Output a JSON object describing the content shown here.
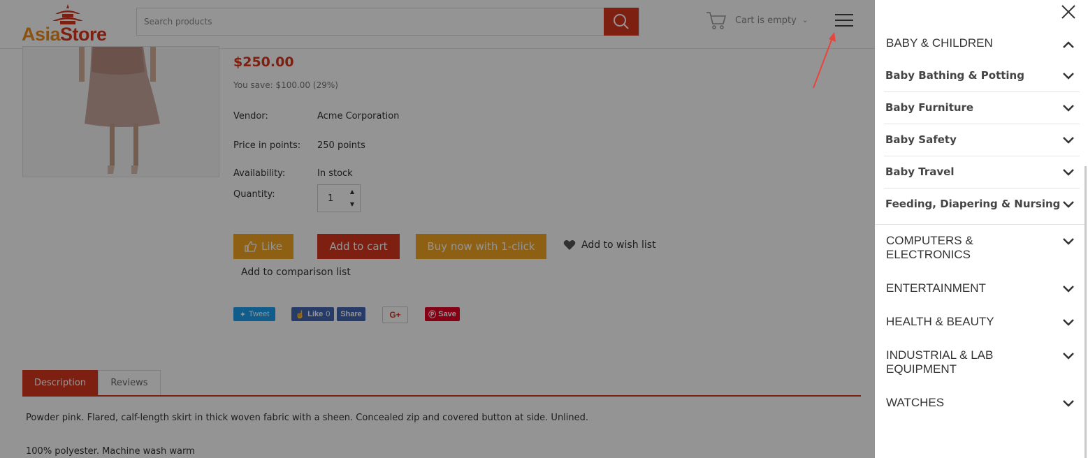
{
  "header": {
    "logo_part1": "Asia",
    "logo_part2": "Store",
    "search_placeholder": "Search products",
    "cart_label": "Cart is empty"
  },
  "product": {
    "price": "$250.00",
    "you_save": "You save: $100.00 (29%)",
    "attributes": [
      {
        "label": "Vendor:",
        "value": "Acme Corporation"
      },
      {
        "label": "Price in points:",
        "value": "250 points"
      },
      {
        "label": "Availability:",
        "value": "In stock"
      },
      {
        "label": "Quantity:",
        "value": ""
      }
    ],
    "quantity": "1",
    "buttons": {
      "like": "Like",
      "add_to_cart": "Add to cart",
      "buy_now": "Buy now with 1-click",
      "wish": "Add to wish list",
      "compare": "Add to comparison list"
    },
    "social": {
      "tweet": "Tweet",
      "fb_like": "Like",
      "fb_count": "0",
      "share": "Share",
      "gplus": "G+",
      "pin_save": "Save"
    },
    "tabs": [
      "Description",
      "Reviews"
    ],
    "description": [
      "Powder pink. Flared, calf-length skirt in thick woven fabric with a sheen. Concealed zip and covered button at side. Unlined.",
      "100% polyester. Machine wash warm"
    ]
  },
  "drawer": {
    "categories": [
      {
        "label": "BABY & CHILDREN",
        "expanded": true
      },
      {
        "label": "COMPUTERS & ELECTRONICS",
        "expanded": false
      },
      {
        "label": "ENTERTAINMENT",
        "expanded": false
      },
      {
        "label": "HEALTH & BEAUTY",
        "expanded": false
      },
      {
        "label": "INDUSTRIAL & LAB EQUIPMENT",
        "expanded": false
      },
      {
        "label": "WATCHES",
        "expanded": false
      }
    ],
    "subcategories": [
      "Baby Bathing & Potting",
      "Baby Furniture",
      "Baby Safety",
      "Baby Travel",
      "Feeding, Diapering & Nursing"
    ]
  },
  "colors": {
    "accent": "#d9381e",
    "orange": "#f5a623",
    "overlay": "rgba(0,0,0,0.42)",
    "annotation_arrow": "#e8453c"
  },
  "icons": {
    "search": "search-icon",
    "cart": "cart-icon",
    "menu": "hamburger-menu-icon",
    "close": "close-icon",
    "chevron": "chevron-down-icon",
    "heart": "heart-icon"
  }
}
